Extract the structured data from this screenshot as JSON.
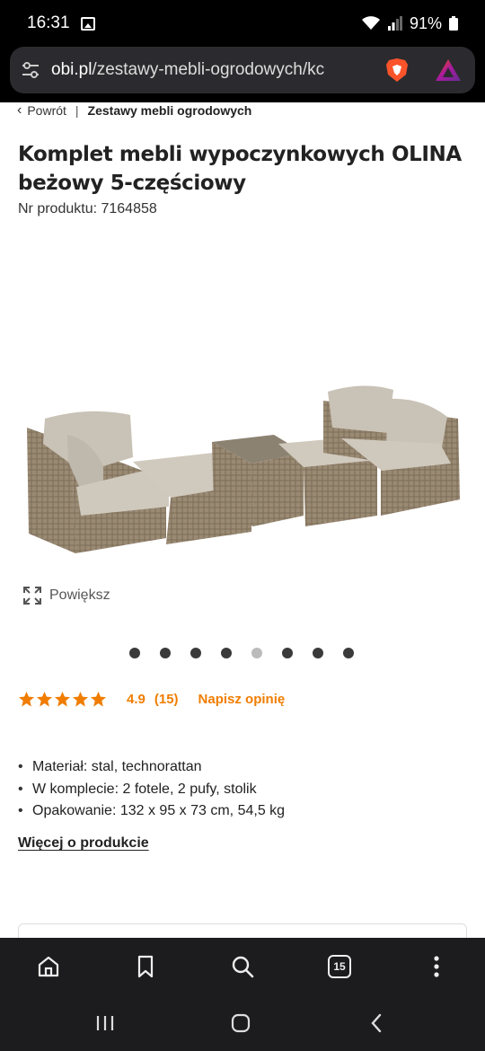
{
  "status_bar": {
    "time": "16:31",
    "battery": "91%"
  },
  "browser": {
    "url_host": "obi.pl",
    "url_path": "/zestawy-mebli-ogrodowych/kc",
    "tab_count": "15"
  },
  "breadcrumb": {
    "back_label": "Powrót",
    "category_label": "Zestawy mebli ogrodowych"
  },
  "product": {
    "title": "Komplet mebli wypoczynkowych OLINA beżowy 5-częściowy",
    "number_label": "Nr produktu: 7164858",
    "zoom_label": "Powiększ",
    "gallery": {
      "total": 8,
      "active_index": 4
    },
    "rating": {
      "stars": 5,
      "score": "4.9",
      "count": "(15)",
      "review_link": "Napisz opinię",
      "star_color": "#f07d00"
    },
    "features": [
      "Materiał: stal, technorattan",
      "W komplecie: 2 fotele, 2 pufy, stolik",
      "Opakowanie: 132 x 95 x 73 cm, 54,5 kg"
    ],
    "more_link": "Więcej o produkcie"
  },
  "colors": {
    "accent": "#f07d00",
    "dark": "#000000",
    "toolbar": "#1c1c1e"
  }
}
